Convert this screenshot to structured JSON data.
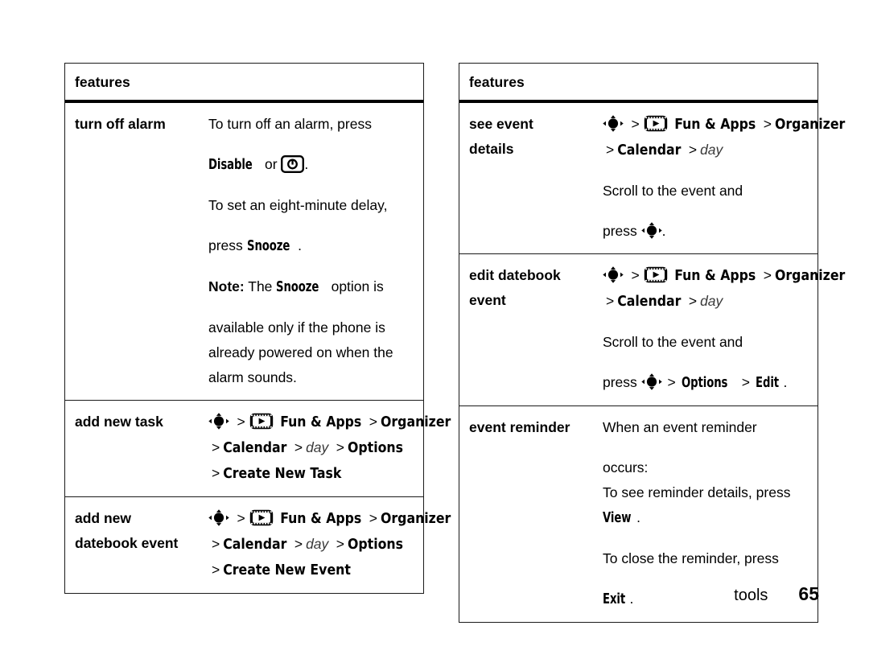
{
  "page": {
    "section_label": "tools",
    "page_number": "65"
  },
  "tables": [
    {
      "id": "left",
      "header": "features",
      "rows": [
        {
          "label_lines": [
            "turn off alarm"
          ],
          "blocks": [
            {
              "type": "text",
              "segments": [
                {
                  "t": "To turn off an alarm, press"
                }
              ]
            },
            {
              "type": "text",
              "same_para": true,
              "segments": [
                {
                  "t": "Disable",
                  "style": "key"
                },
                {
                  "t": " or "
                },
                {
                  "t": "",
                  "icon": "power-alarm-icon"
                },
                {
                  "t": "."
                }
              ]
            },
            {
              "type": "text",
              "segments": [
                {
                  "t": "To set an eight-minute delay,"
                }
              ]
            },
            {
              "type": "text",
              "same_para": true,
              "segments": [
                {
                  "t": "press "
                },
                {
                  "t": "Snooze",
                  "style": "key"
                },
                {
                  "t": "."
                }
              ]
            },
            {
              "type": "text",
              "segments": [
                {
                  "t": "Note:",
                  "style": "bold"
                },
                {
                  "t": " The "
                },
                {
                  "t": "Snooze",
                  "style": "key"
                },
                {
                  "t": " option is"
                }
              ]
            },
            {
              "type": "text",
              "same_para": true,
              "segments": [
                {
                  "t": "available only if the phone is"
                }
              ]
            },
            {
              "type": "text",
              "same_para": true,
              "segments": [
                {
                  "t": "already powered on when the"
                }
              ]
            },
            {
              "type": "text",
              "same_para": true,
              "segments": [
                {
                  "t": "alarm sounds."
                }
              ]
            }
          ]
        },
        {
          "label_lines": [
            "add new task"
          ],
          "menu_lines": [
            [
              {
                "icon": "nav-key-icon"
              },
              {
                "sep": ">"
              },
              {
                "icon": "fun-apps-icon"
              },
              {
                "t": "Fun & Apps"
              },
              {
                "sep": ">"
              },
              {
                "t": "Organizer"
              }
            ],
            [
              {
                "sep": ">"
              },
              {
                "t": "Calendar"
              },
              {
                "sep": ">"
              },
              {
                "t": "day",
                "style": "italic"
              },
              {
                "sep": ">"
              },
              {
                "t": "Options"
              }
            ],
            [
              {
                "sep": ">"
              },
              {
                "t": "Create New Task"
              }
            ]
          ]
        },
        {
          "label_lines": [
            "add new",
            "datebook event"
          ],
          "menu_lines": [
            [
              {
                "icon": "nav-key-icon"
              },
              {
                "sep": ">"
              },
              {
                "icon": "fun-apps-icon"
              },
              {
                "t": "Fun & Apps"
              },
              {
                "sep": ">"
              },
              {
                "t": "Organizer"
              }
            ],
            [
              {
                "sep": ">"
              },
              {
                "t": "Calendar"
              },
              {
                "sep": ">"
              },
              {
                "t": "day",
                "style": "italic"
              },
              {
                "sep": ">"
              },
              {
                "t": "Options"
              }
            ],
            [
              {
                "sep": ">"
              },
              {
                "t": "Create New Event"
              }
            ]
          ]
        }
      ]
    },
    {
      "id": "right",
      "header": "features",
      "rows": [
        {
          "label_lines": [
            "see event",
            "details"
          ],
          "menu_lines": [
            [
              {
                "icon": "nav-key-icon"
              },
              {
                "sep": ">"
              },
              {
                "icon": "fun-apps-icon"
              },
              {
                "t": "Fun & Apps"
              },
              {
                "sep": ">"
              },
              {
                "t": "Organizer"
              }
            ],
            [
              {
                "sep": ">"
              },
              {
                "t": "Calendar"
              },
              {
                "sep": ">"
              },
              {
                "t": "day",
                "style": "italic"
              }
            ]
          ],
          "blocks": [
            {
              "type": "text",
              "segments": [
                {
                  "t": "Scroll to the event and"
                }
              ]
            },
            {
              "type": "text",
              "same_para": true,
              "segments": [
                {
                  "t": "press "
                },
                {
                  "t": "",
                  "icon": "nav-key-icon"
                },
                {
                  "t": "."
                }
              ]
            }
          ]
        },
        {
          "label_lines": [
            "edit datebook",
            "event"
          ],
          "menu_lines": [
            [
              {
                "icon": "nav-key-icon"
              },
              {
                "sep": ">"
              },
              {
                "icon": "fun-apps-icon"
              },
              {
                "t": "Fun & Apps"
              },
              {
                "sep": ">"
              },
              {
                "t": "Organizer"
              }
            ],
            [
              {
                "sep": ">"
              },
              {
                "t": "Calendar"
              },
              {
                "sep": ">"
              },
              {
                "t": "day",
                "style": "italic"
              }
            ]
          ],
          "blocks": [
            {
              "type": "text",
              "segments": [
                {
                  "t": "Scroll to the event and"
                }
              ]
            },
            {
              "type": "text",
              "same_para": true,
              "segments": [
                {
                  "t": "press "
                },
                {
                  "t": "",
                  "icon": "nav-key-icon"
                },
                {
                  "t": " "
                },
                {
                  "t": ">",
                  "style": "sep"
                },
                {
                  "t": " "
                },
                {
                  "t": "Options",
                  "style": "key"
                },
                {
                  "t": " "
                },
                {
                  "t": ">",
                  "style": "sep"
                },
                {
                  "t": " "
                },
                {
                  "t": "Edit",
                  "style": "key"
                },
                {
                  "t": "."
                }
              ]
            }
          ]
        },
        {
          "label_lines": [
            "event reminder"
          ],
          "blocks": [
            {
              "type": "text",
              "segments": [
                {
                  "t": "When an event reminder"
                }
              ]
            },
            {
              "type": "text",
              "same_para": true,
              "segments": [
                {
                  "t": "occurs:"
                }
              ]
            },
            {
              "type": "text",
              "same_para": true,
              "segments": [
                {
                  "t": "To see reminder details, press"
                }
              ]
            },
            {
              "type": "text",
              "same_para": true,
              "segments": [
                {
                  "t": "View",
                  "style": "key"
                },
                {
                  "t": "."
                }
              ]
            },
            {
              "type": "text",
              "segments": [
                {
                  "t": "To close the reminder, press"
                }
              ]
            },
            {
              "type": "text",
              "same_para": true,
              "segments": [
                {
                  "t": "Exit",
                  "style": "key"
                },
                {
                  "t": "."
                }
              ]
            }
          ]
        }
      ]
    }
  ],
  "icons": {
    "nav-key-icon": "navigation-key",
    "fun-apps-icon": "film-strip-play",
    "power-alarm-icon": "power-key"
  }
}
